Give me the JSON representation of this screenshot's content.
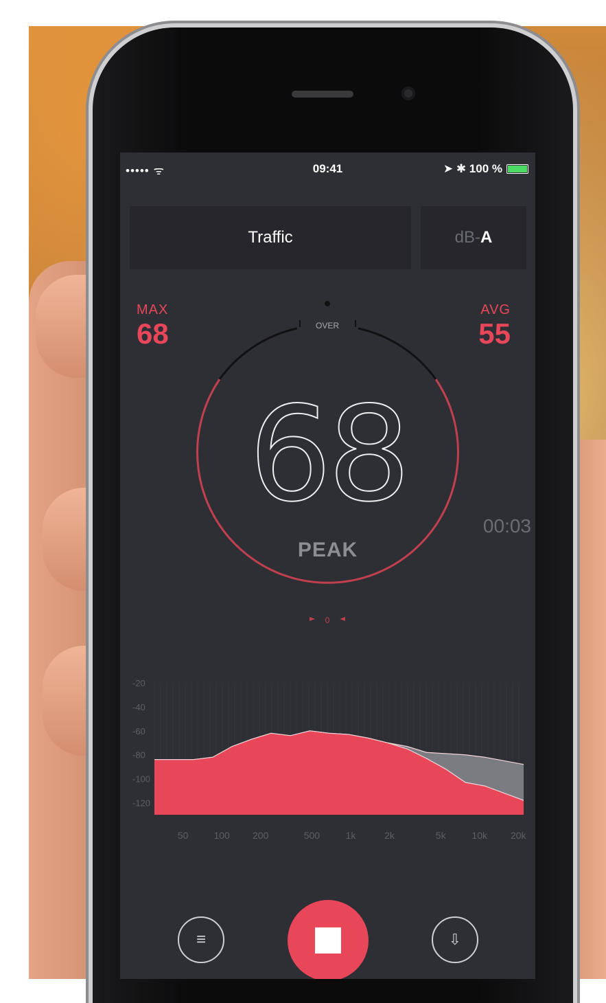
{
  "status_bar": {
    "signal": "••••• ᯤ",
    "time": "09:41",
    "right": "➤ ✱ 100 %"
  },
  "preset": {
    "label": "Traffic"
  },
  "unit": {
    "prefix": "dB-",
    "weighting": "A"
  },
  "max": {
    "label": "MAX",
    "value": "68"
  },
  "avg": {
    "label": "AVG",
    "value": "55"
  },
  "gauge": {
    "over_label": "OVER",
    "reading": "68",
    "mode_label": "PEAK",
    "bottom_marker": "0"
  },
  "timer": "00:03",
  "chart_data": {
    "type": "area",
    "y_tick_labels": [
      "-20",
      "-40",
      "-60",
      "-80",
      "-100",
      "-120"
    ],
    "x_tick_labels": [
      "50",
      "100",
      "200",
      "500",
      "1k",
      "2k",
      "5k",
      "10k",
      "20k"
    ],
    "ylim": [
      -130,
      -20
    ],
    "series": [
      {
        "color": "#e8475a",
        "values": [
          -84,
          -84,
          -84,
          -82,
          -73,
          -67,
          -62,
          -64,
          -60,
          -62,
          -63,
          -66,
          -70,
          -75,
          -83,
          -92,
          -103,
          -106,
          -112,
          -118
        ]
      },
      {
        "color": "#7b7b82",
        "values": [
          -84,
          -84,
          -84,
          -82,
          -73,
          -67,
          -62,
          -64,
          -60,
          -62,
          -63,
          -66,
          -70,
          -73,
          -78,
          -79,
          -80,
          -82,
          -85,
          -88
        ]
      }
    ]
  },
  "controls": {
    "menu_icon": "≡",
    "save_icon": "⇩"
  },
  "colors": {
    "accent": "#e8475a",
    "screen_bg": "#2e2e35",
    "panel_bg": "#26262c"
  }
}
